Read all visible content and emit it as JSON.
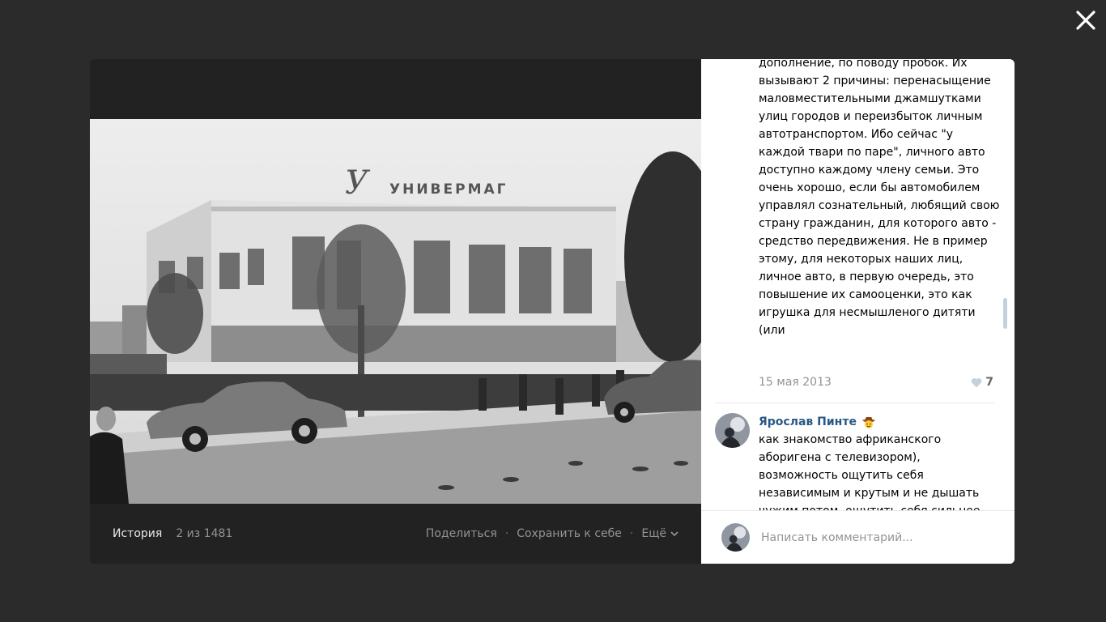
{
  "photo": {
    "alt": "",
    "sign_text": "УНИВЕРМАГ"
  },
  "footer": {
    "album": "История",
    "counter": "2 из 1481",
    "share": "Поделиться",
    "save": "Сохранить к себе",
    "more": "Ещё"
  },
  "comments": [
    {
      "text": "дополнение, по поводу пробок. Их вызывают 2 причины: перенасыщение маловместительными джамшутками улиц городов и переизбыток личным автотранспортом. Ибо сейчас \"у каждой твари по паре\", личного авто доступно каждому члену семьи. Это очень хорошо, если бы автомобилем управлял сознательный, любящий свою страну гражданин, для которого авто - средство передвижения. Не в пример этому, для некоторых наших лиц, личное авто, в первую очередь, это повышение их самооценки, это как игрушка для несмышленого дитяти (или",
      "date": "15 мая 2013",
      "likes": "7"
    },
    {
      "author": "Ярослав Пинте",
      "text": "как знакомство африканского аборигена с телевизором), возможность ощутить себя независимым и крутым и не дышать чужим потом, ощутить себя сильнее"
    }
  ],
  "composer": {
    "placeholder": "Написать комментарий..."
  },
  "colors": {
    "overlay": "#2b2b2c",
    "footer_bg": "#222222",
    "link": "#2a5885",
    "muted": "#939393"
  },
  "icons": [
    "close-icon",
    "chevron-down-icon",
    "heart-icon",
    "cowboy-emoji-icon"
  ]
}
